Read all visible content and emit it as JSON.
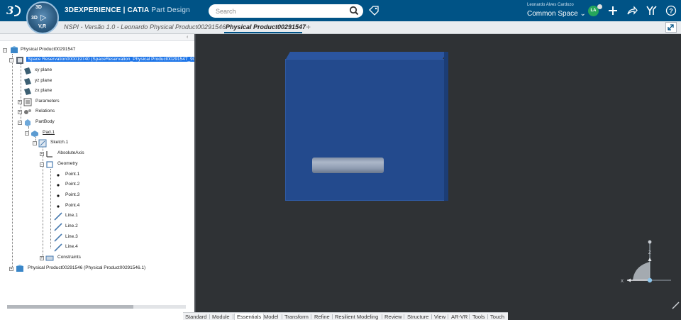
{
  "header": {
    "brand_prefix": "3D",
    "brand_main": "EXPERIENCE | CATIA",
    "brand_app": "Part Design",
    "compass_top": "3D",
    "compass_left": "3D",
    "compass_vr": "V,R",
    "search_placeholder": "Search",
    "user_name": "Leonardo Alves Cardozo",
    "space_label": "Common Space",
    "avatar_initials": "LA",
    "accent_color": "#005386"
  },
  "tabs": [
    {
      "label": "NSPI - Versão 1.0 - Leonardo",
      "active": false
    },
    {
      "label": "Physical Product00291546",
      "active": false
    },
    {
      "label": "Physical Product00291547",
      "active": true
    }
  ],
  "tree": {
    "root": "Physical Product00291547",
    "selected": "Space Reservation000019740 (SpaceReservation_Physical Product00291547_906",
    "xy": "xy plane",
    "yz": "yz plane",
    "zx": "zx plane",
    "parameters": "Parameters",
    "relations": "Relations",
    "partbody": "PartBody",
    "pad": "Pad.1",
    "sketch": "Sketch.1",
    "absaxis": "AbsoluteAxis",
    "geometry": "Geometry",
    "points": [
      "Point.1",
      "Point.2",
      "Point.3",
      "Point.4"
    ],
    "lines": [
      "Line.1",
      "Line.2",
      "Line.3",
      "Line.4"
    ],
    "constraints": "Constraints",
    "other_product": "Physical Product00291546 (Physical Product00291546.1)"
  },
  "viewport": {
    "axis_z": "Z",
    "axis_x": "X",
    "box_color": "#234a8d"
  },
  "action_bar": {
    "tabs": [
      "Standard",
      "Module",
      "Essentials",
      "Model",
      "Transform",
      "Refine",
      "Resilient Modeling",
      "Review",
      "Structure",
      "View",
      "AR-VR",
      "Tools",
      "Touch"
    ],
    "active": "Essentials"
  }
}
